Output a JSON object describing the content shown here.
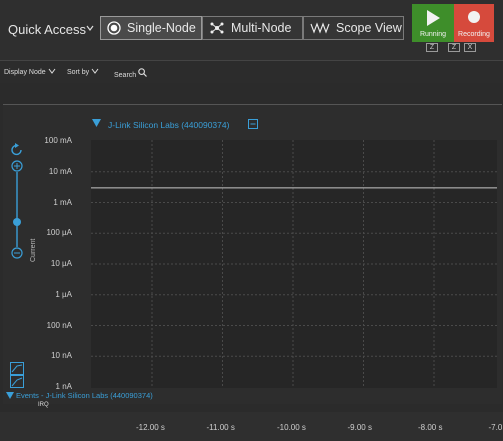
{
  "toolbar": {
    "quick_access": "Quick Access",
    "modes": [
      {
        "label": "Single-Node",
        "icon": "radio-icon",
        "active": true
      },
      {
        "label": "Multi-Node",
        "icon": "nodes-icon",
        "active": false
      },
      {
        "label": "Scope View",
        "icon": "waveform-icon",
        "active": false
      }
    ],
    "running": {
      "label": "Running",
      "icon": "play-icon",
      "color": "#3e8e2a"
    },
    "recording": {
      "label": "Recording",
      "icon": "record-icon",
      "color": "#d64a3c"
    },
    "keys": [
      "Z",
      "Z",
      "X"
    ]
  },
  "subbar": {
    "display_node": "Display Node",
    "sort_by": "Sort by",
    "search": "Search"
  },
  "panel": {
    "node_title": "J-Link Silicon Labs (440090374)",
    "events_title": "Events - J-Link Silicon Labs (440090374)",
    "irq": "IRQ",
    "accent": "#3a9fd8"
  },
  "chart_data": {
    "type": "line",
    "ylabel": "Current",
    "y_scale": "log",
    "y_ticks": [
      "100 mA",
      "10 mA",
      "1 mA",
      "100 µA",
      "10 µA",
      "1 µA",
      "100 nA",
      "10 nA",
      "1 nA"
    ],
    "x_ticks": [
      "-12.00 s",
      "-11.00 s",
      "-10.00 s",
      "-9.00 s",
      "-8.00 s",
      "-7.0"
    ],
    "series": [
      {
        "values": [
          {
            "x": -13.0,
            "y": "3 mA"
          },
          {
            "x": -7.0,
            "y": "3 mA"
          }
        ]
      }
    ],
    "grid": true
  }
}
